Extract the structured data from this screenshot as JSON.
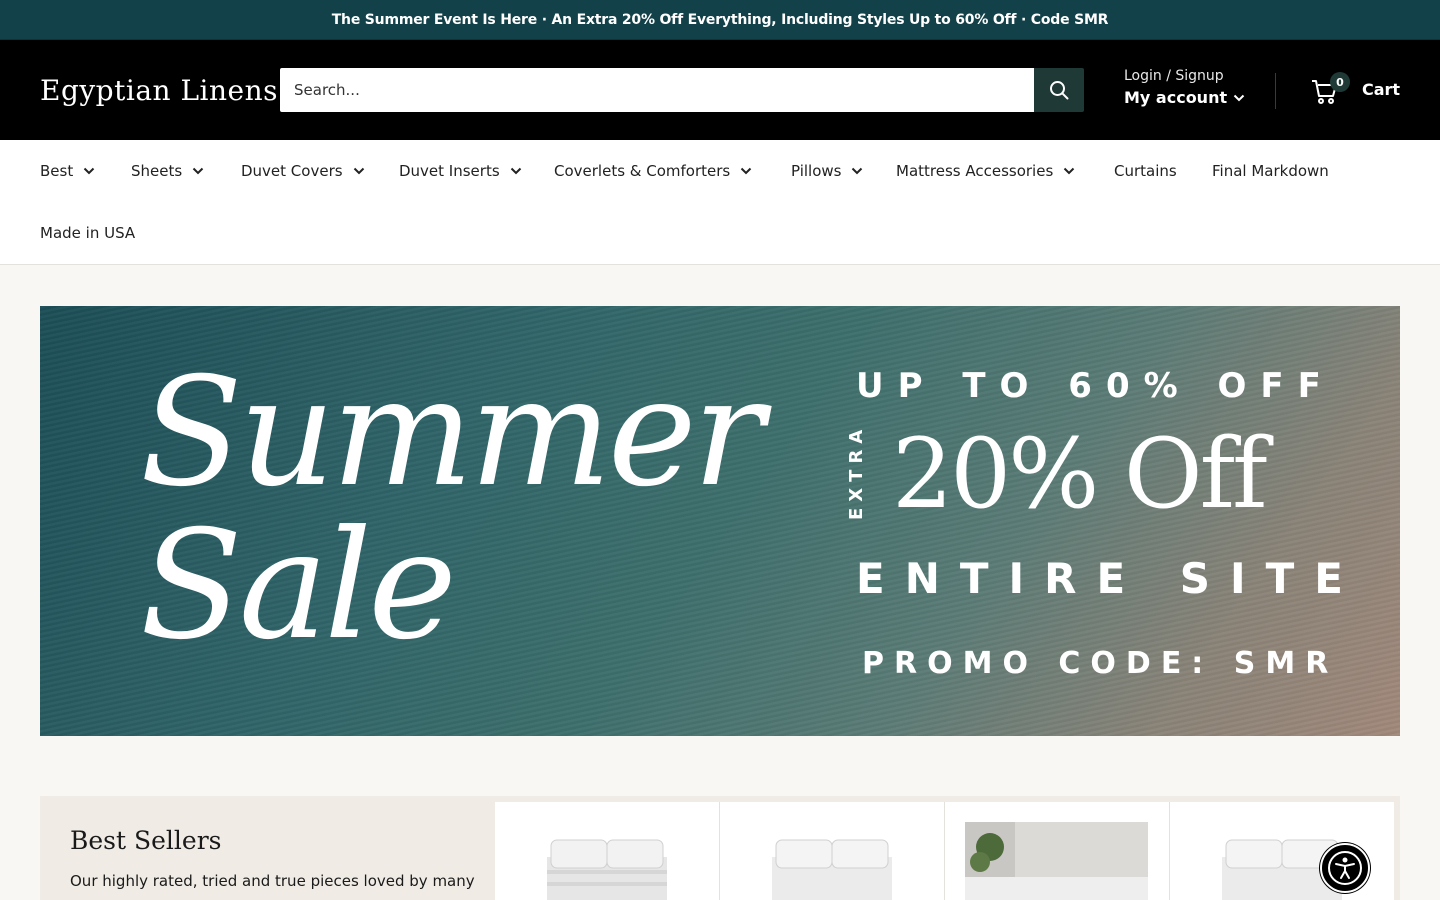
{
  "announcement": "The Summer Event Is Here · An Extra 20% Off Everything, Including Styles Up to 60% Off · Code SMR",
  "header": {
    "logo": "Egyptian Linens",
    "search_placeholder": "Search...",
    "login_label": "Login / Signup",
    "account_label": "My account",
    "cart_count": "0",
    "cart_label": "Cart"
  },
  "nav": {
    "items": [
      {
        "label": "Best",
        "dropdown": true
      },
      {
        "label": "Sheets",
        "dropdown": true
      },
      {
        "label": "Duvet Covers",
        "dropdown": true
      },
      {
        "label": "Duvet Inserts",
        "dropdown": true
      },
      {
        "label": "Coverlets & Comforters",
        "dropdown": true
      },
      {
        "label": "Pillows",
        "dropdown": true
      },
      {
        "label": "Mattress Accessories",
        "dropdown": true
      },
      {
        "label": "Curtains",
        "dropdown": false
      },
      {
        "label": "Final Markdown",
        "dropdown": false
      },
      {
        "label": "Made in USA",
        "dropdown": false
      }
    ]
  },
  "hero": {
    "line1": "Summer",
    "line2": "Sale",
    "up_to": "UP TO 60% OFF",
    "extra": "EXTRA",
    "discount": "20% Off",
    "entire": "ENTIRE SITE",
    "promo": "PROMO CODE: SMR"
  },
  "best_sellers": {
    "title": "Best Sellers",
    "description": "Our highly rated, tried and true pieces loved by many"
  },
  "colors": {
    "announcement_bg": "#124149",
    "header_bg": "#000000",
    "search_button_bg": "#1f3a36",
    "page_bg": "#f8f7f3"
  }
}
